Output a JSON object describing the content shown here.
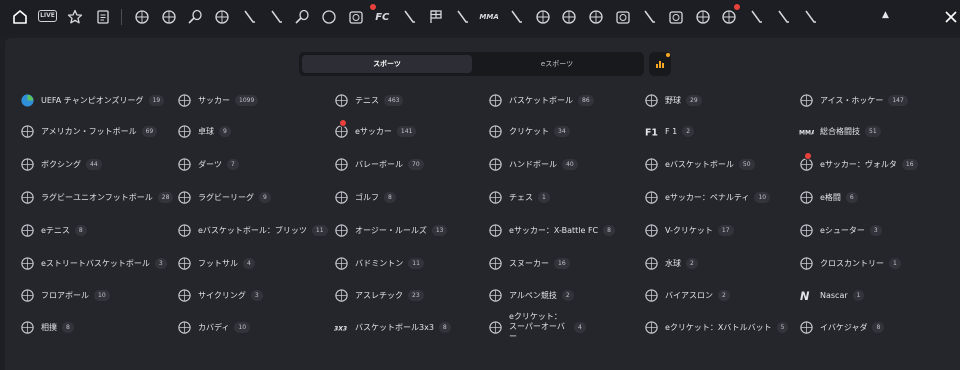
{
  "topbar": {
    "live_label": "LIVE",
    "icons": [
      "home-icon",
      "live-icon",
      "star-icon",
      "betslip-icon",
      "globe-soccer-icon",
      "soccer-icon",
      "tennis-icon",
      "basketball-icon",
      "cricket-icon",
      "hockey-icon",
      "table-tennis-icon",
      "tennis-ball-icon",
      "esoccer-icon",
      "fc-icon",
      "cricket-bat-icon",
      "racing-flag-icon",
      "shooter-icon",
      "mma-icon",
      "boxing-icon",
      "darts-icon",
      "volleyball-icon",
      "handball-icon",
      "ebasketball-icon",
      "valorant-icon",
      "esoccer-volta-icon",
      "rugby-icon",
      "american-football-icon",
      "golf-icon",
      "valorant-logo-icon",
      "chess-icon"
    ]
  },
  "tabs": {
    "sports": "スポーツ",
    "esports": "eスポーツ"
  },
  "sports": [
    {
      "name": "UEFA チャンピオンズリーグ",
      "count": "19",
      "icon": "ucl-icon"
    },
    {
      "name": "サッカー",
      "count": "1099",
      "icon": "soccer-icon"
    },
    {
      "name": "テニス",
      "count": "463",
      "icon": "tennis-icon"
    },
    {
      "name": "バスケットボール",
      "count": "86",
      "icon": "basketball-icon"
    },
    {
      "name": "野球",
      "count": "29",
      "icon": "baseball-icon"
    },
    {
      "name": "アイス・ホッケー",
      "count": "147",
      "icon": "hockey-icon"
    },
    {
      "name": "アメリカン・フットボール",
      "count": "69",
      "icon": "american-football-icon"
    },
    {
      "name": "卓球",
      "count": "9",
      "icon": "table-tennis-icon"
    },
    {
      "name": "eサッカー",
      "count": "141",
      "icon": "esoccer-icon"
    },
    {
      "name": "クリケット",
      "count": "34",
      "icon": "cricket-icon"
    },
    {
      "name": "F 1",
      "count": "2",
      "icon": "f1-icon"
    },
    {
      "name": "総合格闘技",
      "count": "51",
      "icon": "mma-icon"
    },
    {
      "name": "ボクシング",
      "count": "44",
      "icon": "boxing-icon"
    },
    {
      "name": "ダーツ",
      "count": "7",
      "icon": "darts-icon"
    },
    {
      "name": "バレーボール",
      "count": "70",
      "icon": "volleyball-icon"
    },
    {
      "name": "ハンドボール",
      "count": "40",
      "icon": "handball-icon"
    },
    {
      "name": "eバスケットボール",
      "count": "50",
      "icon": "ebasketball-icon"
    },
    {
      "name": "eサッカー：ヴォルタ",
      "count": "16",
      "icon": "esoccer-volta-icon"
    },
    {
      "name": "ラグビーユニオンフットボール",
      "count": "28",
      "icon": "rugby-union-icon"
    },
    {
      "name": "ラグビーリーグ",
      "count": "9",
      "icon": "rugby-league-icon"
    },
    {
      "name": "ゴルフ",
      "count": "8",
      "icon": "golf-icon"
    },
    {
      "name": "チェス",
      "count": "1",
      "icon": "chess-icon"
    },
    {
      "name": "eサッカー：ペナルティ",
      "count": "10",
      "icon": "esoccer-penalty-icon"
    },
    {
      "name": "e格闘",
      "count": "6",
      "icon": "efighting-icon"
    },
    {
      "name": "eテニス",
      "count": "8",
      "icon": "etennis-icon"
    },
    {
      "name": "eバスケットボール：ブリッツ",
      "count": "11",
      "icon": "ebasketball-blitz-icon"
    },
    {
      "name": "オージー・ルールズ",
      "count": "13",
      "icon": "aussie-rules-icon"
    },
    {
      "name": "eサッカー：X-Battle FC",
      "count": "8",
      "icon": "esoccer-xbattle-icon"
    },
    {
      "name": "V-クリケット",
      "count": "17",
      "icon": "vcricket-icon"
    },
    {
      "name": "eシューター",
      "count": "3",
      "icon": "eshooter-icon"
    },
    {
      "name": "eストリートバスケットボール",
      "count": "3",
      "icon": "estreetball-icon"
    },
    {
      "name": "フットサル",
      "count": "4",
      "icon": "futsal-icon"
    },
    {
      "name": "バドミントン",
      "count": "11",
      "icon": "badminton-icon"
    },
    {
      "name": "スヌーカー",
      "count": "16",
      "icon": "snooker-icon"
    },
    {
      "name": "水球",
      "count": "2",
      "icon": "water-polo-icon"
    },
    {
      "name": "クロスカントリー",
      "count": "1",
      "icon": "cross-country-icon"
    },
    {
      "name": "フロアボール",
      "count": "10",
      "icon": "floorball-icon"
    },
    {
      "name": "サイクリング",
      "count": "3",
      "icon": "cycling-icon"
    },
    {
      "name": "アスレチック",
      "count": "23",
      "icon": "athletics-icon"
    },
    {
      "name": "アルペン競技",
      "count": "2",
      "icon": "alpine-skiing-icon"
    },
    {
      "name": "バイアスロン",
      "count": "2",
      "icon": "biathlon-icon"
    },
    {
      "name": "Nascar",
      "count": "1",
      "icon": "nascar-icon"
    },
    {
      "name": "相撲",
      "count": "8",
      "icon": "sumo-icon"
    },
    {
      "name": "カバディ",
      "count": "10",
      "icon": "kabaddi-icon"
    },
    {
      "name": "バスケットボール3x3",
      "count": "8",
      "icon": "basketball-3x3-icon"
    },
    {
      "name": "eクリケット：\nスーパーオーバー",
      "count": "4",
      "icon": "ecricket-superover-icon"
    },
    {
      "name": "eクリケット：Xバトルバット",
      "count": "5",
      "icon": "ecricket-xbattlebat-icon"
    },
    {
      "name": "イバケジャダ",
      "count": "8",
      "icon": "ibakejada-icon"
    }
  ]
}
